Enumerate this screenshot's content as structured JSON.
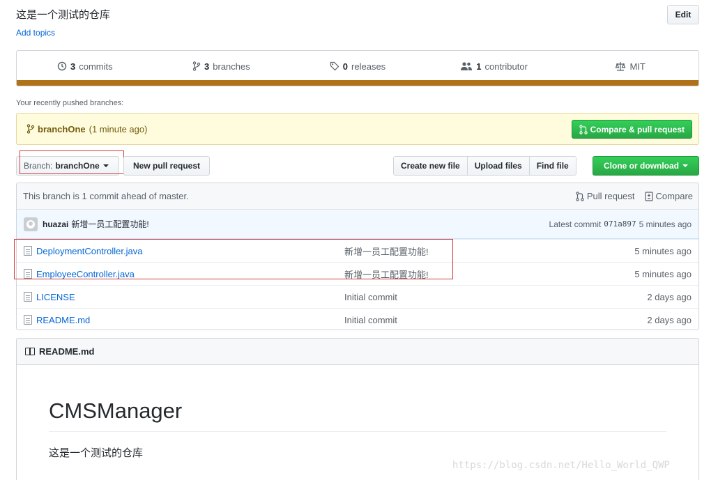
{
  "repo": {
    "description": "这是一个测试的仓库",
    "add_topics": "Add topics",
    "edit_label": "Edit"
  },
  "summary": {
    "commits_count": "3",
    "commits_label": "commits",
    "branches_count": "3",
    "branches_label": "branches",
    "releases_count": "0",
    "releases_label": "releases",
    "contributors_count": "1",
    "contributors_label": "contributor",
    "license": "MIT",
    "language_color": "#b07219"
  },
  "recent": {
    "label": "Your recently pushed branches:",
    "branch": "branchOne",
    "time": "(1 minute ago)",
    "compare_label": "Compare & pull request"
  },
  "toolbar": {
    "branch_label": "Branch:",
    "branch_value": "branchOne",
    "new_pr_label": "New pull request",
    "create_file_label": "Create new file",
    "upload_files_label": "Upload files",
    "find_file_label": "Find file",
    "clone_label": "Clone or download"
  },
  "branch_info": {
    "ahead_text": "This branch is 1 commit ahead of master.",
    "pull_request_label": "Pull request",
    "compare_label": "Compare"
  },
  "latest_commit": {
    "author": "huazai",
    "message": "新增一员工配置功能!",
    "prefix": "Latest commit",
    "sha": "071a897",
    "age": "5 minutes ago"
  },
  "files": [
    {
      "name": "DeploymentController.java",
      "message": "新增一员工配置功能!",
      "age": "5 minutes ago"
    },
    {
      "name": "EmployeeController.java",
      "message": "新增一员工配置功能!",
      "age": "5 minutes ago"
    },
    {
      "name": "LICENSE",
      "message": "Initial commit",
      "age": "2 days ago"
    },
    {
      "name": "README.md",
      "message": "Initial commit",
      "age": "2 days ago"
    }
  ],
  "readme": {
    "header": "README.md",
    "title": "CMSManager",
    "text": "这是一个测试的仓库"
  },
  "watermark": "https://blog.csdn.net/Hello_World_QWP"
}
